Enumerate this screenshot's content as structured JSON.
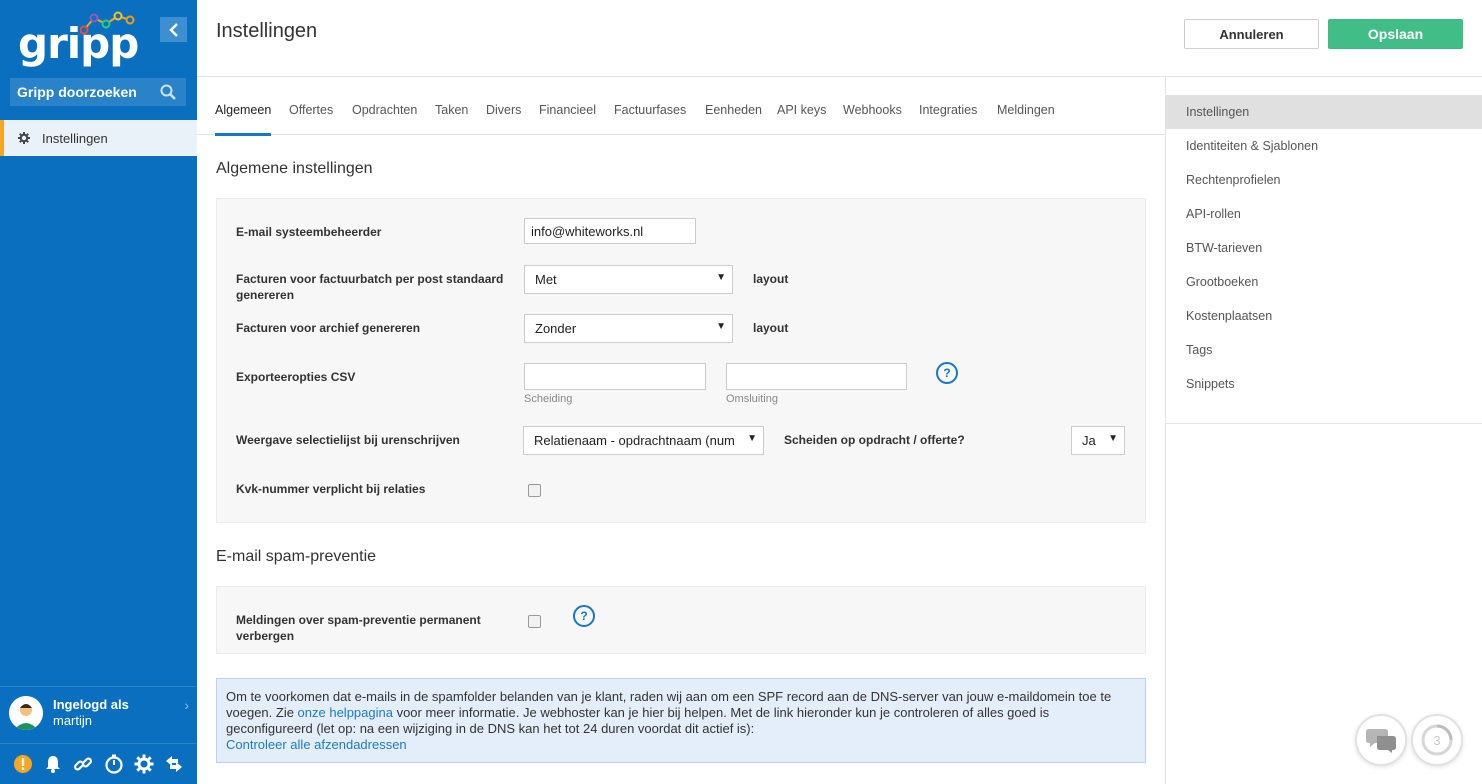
{
  "app": {
    "logo_text": "gripp"
  },
  "sidebar": {
    "search_label": "Gripp doorzoeken",
    "items": [
      {
        "label": "Instellingen",
        "icon": "gear-icon"
      }
    ],
    "user": {
      "line1": "Ingelogd als",
      "line2": "martijn"
    },
    "bottom_icons": [
      "alert-icon",
      "bell-icon",
      "link-icon",
      "timer-icon",
      "gear-icon",
      "switch-icon"
    ]
  },
  "header": {
    "title": "Instellingen",
    "cancel_label": "Annuleren",
    "save_label": "Opslaan"
  },
  "tabs": [
    "Algemeen",
    "Offertes",
    "Opdrachten",
    "Taken",
    "Divers",
    "Financieel",
    "Factuurfases",
    "Eenheden",
    "API keys",
    "Webhooks",
    "Integraties",
    "Meldingen"
  ],
  "active_tab": "Algemeen",
  "right_menu": [
    "Instellingen",
    "Identiteiten & Sjablonen",
    "Rechtenprofielen",
    "API-rollen",
    "BTW-tarieven",
    "Grootboeken",
    "Kostenplaatsen",
    "Tags",
    "Snippets"
  ],
  "general": {
    "title": "Algemene instellingen",
    "email_label": "E-mail systeembeheerder",
    "email_value": "info@whiteworks.nl",
    "post_label": "Facturen voor factuurbatch per post standaard genereren",
    "post_value": "Met",
    "post_suffix": "layout",
    "archive_label": "Facturen voor archief genereren",
    "archive_value": "Zonder",
    "archive_suffix": "layout",
    "csv_label": "Exporteeropties CSV",
    "csv_sep_value": "",
    "csv_sep_hint": "Scheiding",
    "csv_wrap_value": "",
    "csv_wrap_hint": "Omsluiting",
    "help_mark": "?",
    "select_list_label": "Weergave selectielijst bij urenschrijven",
    "select_list_value": "Relatienaam - opdrachtnaam (num",
    "split_label": "Scheiden op opdracht / offerte?",
    "split_value": "Ja",
    "kvk_label": "Kvk-nummer verplicht bij relaties",
    "kvk_checked": false
  },
  "spam": {
    "title": "E-mail spam-preventie",
    "hide_label": "Meldingen over spam-preventie permanent verbergen",
    "hide_checked": false,
    "help_mark": "?"
  },
  "info": {
    "text1": "Om te voorkomen dat e-mails in de spamfolder belanden van je klant, raden wij aan om een SPF record aan de DNS-server van jouw e-maildomein toe te voegen. Zie ",
    "link1": "onze helppagina",
    "text2": " voor meer informatie. Je webhoster kan je hier bij helpen. Met de link hieronder kun je controleren of alles goed is geconfigureerd (let op: na een wijziging in de DNS kan het tot 24 duren voordat dit actief is):",
    "link2": "Controleer alle afzendadressen"
  },
  "floating": {
    "chat_icon": "chat-icon",
    "badge_count": "3"
  },
  "colors": {
    "sidebar": "#0a6fbf",
    "accent": "#1976c8",
    "save": "#41bd88",
    "highlight": "#f5a623"
  }
}
